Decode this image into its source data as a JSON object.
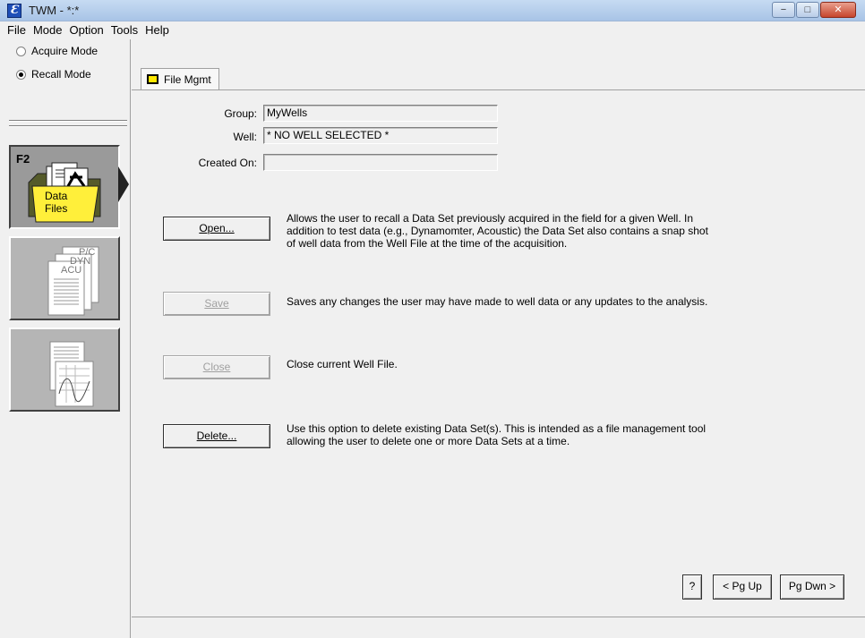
{
  "window": {
    "title": "TWM - *:*",
    "app_icon": "Ɛ",
    "minimize": "−",
    "maximize": "□",
    "close": "✕"
  },
  "menu": [
    "File",
    "Mode",
    "Option",
    "Tools",
    "Help"
  ],
  "sidebar": {
    "acquire_mode": "Acquire Mode",
    "recall_mode": "Recall Mode",
    "selected_mode": "Recall Mode",
    "data_files_key": "F2",
    "data_files_label_1": "Data",
    "data_files_label_2": "Files",
    "report_labels": [
      "P/C",
      "DYN",
      "ACU"
    ]
  },
  "tab": {
    "label": "File Mgmt"
  },
  "fields": {
    "group_label": "Group:",
    "group_value": "MyWells",
    "well_label": "Well:",
    "well_value": "* NO WELL SELECTED *",
    "created_label": "Created On:",
    "created_value": ""
  },
  "actions": {
    "open_label": "Open...",
    "open_desc": "Allows the user to recall a Data Set previously acquired in the field for a given Well.  In addition to test data (e.g.,  Dynamomter, Acoustic) the Data Set also contains a snap shot of well data from the Well File at the time of the acquisition.",
    "save_label": "Save",
    "save_desc": "Saves any changes the user may have made to well data or any updates to the analysis.",
    "close_label": "Close",
    "close_desc": "Close current Well File.",
    "delete_label": "Delete...",
    "delete_desc": "Use this option to delete existing Data Set(s).  This is intended as a file management tool allowing the user to delete one or more Data Sets at a time."
  },
  "footer": {
    "help": "?",
    "pgup": "< Pg Up",
    "pgdn": "Pg Dwn >"
  },
  "colors": {
    "tab_marker": "#ffe800",
    "data_files_folder": "#ffef3a",
    "title_gradient_top": "#c6dbf2"
  }
}
